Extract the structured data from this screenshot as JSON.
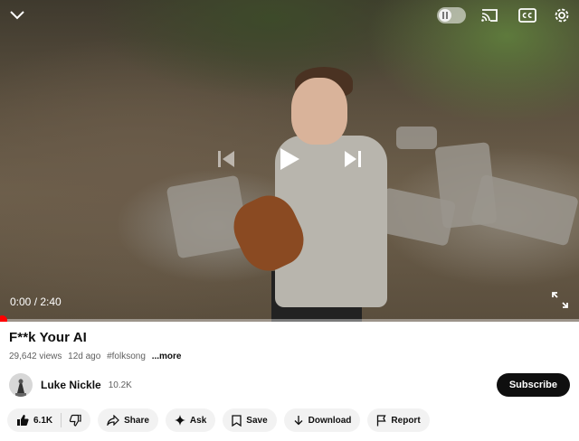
{
  "player": {
    "time_current": "0:00",
    "time_total": "2:40",
    "time_display": "0:00 / 2:40",
    "progress": 0,
    "autoplay": "off",
    "icons": {
      "minimize": "chevron-down-icon",
      "autoplay": "autoplay-toggle",
      "cast": "cast-icon",
      "captions": "captions-icon",
      "settings": "gear-icon",
      "previous": "previous-icon",
      "play": "play-icon",
      "next": "next-icon",
      "fullscreen": "fullscreen-icon"
    },
    "accent_color": "#ff0000"
  },
  "video": {
    "title": "F**k Your AI",
    "views": "29,642 views",
    "age": "12d ago",
    "hashtag": "#folksong",
    "more_label": "...more"
  },
  "channel": {
    "name": "Luke Nickle",
    "subscribers": "10.2K",
    "subscribe_label": "Subscribe"
  },
  "actions": {
    "like_count": "6.1K",
    "share_label": "Share",
    "ask_label": "Ask",
    "save_label": "Save",
    "download_label": "Download",
    "report_label": "Report"
  }
}
